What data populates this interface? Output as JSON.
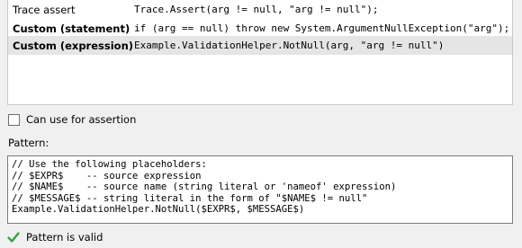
{
  "assertion_methods": [
    {
      "name": "Trace assert",
      "bold": false,
      "code": "Trace.Assert(arg != null, \"arg != null\");"
    },
    {
      "name": "Custom (statement)",
      "bold": true,
      "code": "if (arg == null) throw new System.ArgumentNullException(\"arg\");"
    },
    {
      "name": "Custom (expression)",
      "bold": true,
      "code": "Example.ValidationHelper.NotNull(arg, \"arg != null\")",
      "selected": true
    }
  ],
  "checkbox": {
    "label": "Can use for assertion",
    "checked": false
  },
  "pattern": {
    "label": "Pattern:",
    "lines": [
      "// Use the following placeholders:",
      "// $EXPR$    -- source expression",
      "// $NAME$    -- source name (string literal or 'nameof' expression)",
      "// $MESSAGE$ -- string literal in the form of \"$NAME$ != null\"",
      "Example.ValidationHelper.NotNull($EXPR$, $MESSAGE$)"
    ]
  },
  "status": {
    "text": "Pattern is valid",
    "icon": "checkmark-icon",
    "icon_color": "#2e9e3e"
  }
}
